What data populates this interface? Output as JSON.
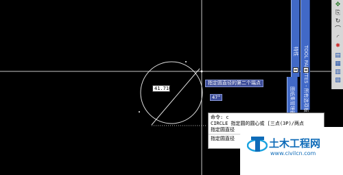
{
  "drawing": {
    "diameter_input": "41.7101",
    "prompt_tooltip": "指定圆直径的第二个端点",
    "angle_input": "47°"
  },
  "palette": {
    "panel1_title": "特性",
    "panel2_title": "TOOL PALETTES - 所有选项板",
    "panel3_title": "图纸集管理器"
  },
  "toolbar": {
    "icons": [
      "move-icon",
      "copy-icon",
      "rotate-icon",
      "arc-icon",
      "fillet-icon",
      "explode-icon",
      "layer-icon",
      "stack-icon",
      "stack-icon-2",
      "stack-icon-3"
    ]
  },
  "command": {
    "lines": [
      "命令: c",
      "CIRCLE 指定圆的圆心或 [三点(3P)/两点",
      "指定圆直径",
      "指定圆直径"
    ]
  },
  "watermark": {
    "title": "土木工程网",
    "url": "www.civilcn.com"
  },
  "colors": {
    "background": "#000000",
    "palette": "#4169c7",
    "tooltip": "#3d4d9a",
    "watermark_blue": "#0e6bb8"
  }
}
